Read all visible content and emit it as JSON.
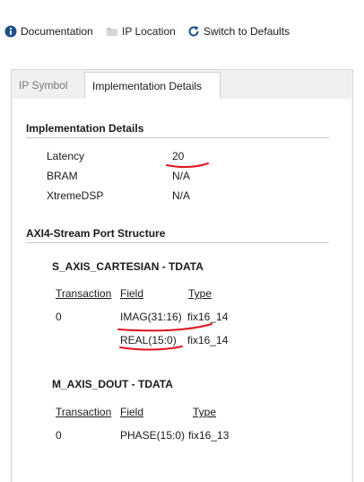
{
  "toolbar": {
    "documentation": "Documentation",
    "ip_location": "IP Location",
    "switch_defaults": "Switch to Defaults"
  },
  "tabs": {
    "ip_symbol": "IP Symbol",
    "implementation_details": "Implementation Details"
  },
  "implementation": {
    "title": "Implementation Details",
    "rows": [
      {
        "label": "Latency",
        "value": "20"
      },
      {
        "label": "BRAM",
        "value": "N/A"
      },
      {
        "label": "XtremeDSP",
        "value": "N/A"
      }
    ]
  },
  "axi": {
    "title": "AXI4-Stream Port Structure",
    "s_axis": {
      "title": "S_AXIS_CARTESIAN - TDATA",
      "headers": {
        "transaction": "Transaction",
        "field": "Field",
        "type": "Type"
      },
      "rows": [
        {
          "transaction": "0",
          "field": "IMAG(31:16)",
          "type": "fix16_14"
        },
        {
          "transaction": "",
          "field": "REAL(15:0)",
          "type": "fix16_14"
        }
      ]
    },
    "m_axis": {
      "title": "M_AXIS_DOUT - TDATA",
      "headers": {
        "transaction": "Transaction",
        "field": "Field",
        "type": "Type"
      },
      "rows": [
        {
          "transaction": "0",
          "field": "PHASE(15:0)",
          "type": "fix16_13"
        }
      ]
    }
  },
  "colors": {
    "annotation": "#e0141e",
    "info_icon": "#1f4e8c",
    "refresh_icon": "#1f4e8c",
    "folder_icon": "#b8b8b8"
  }
}
